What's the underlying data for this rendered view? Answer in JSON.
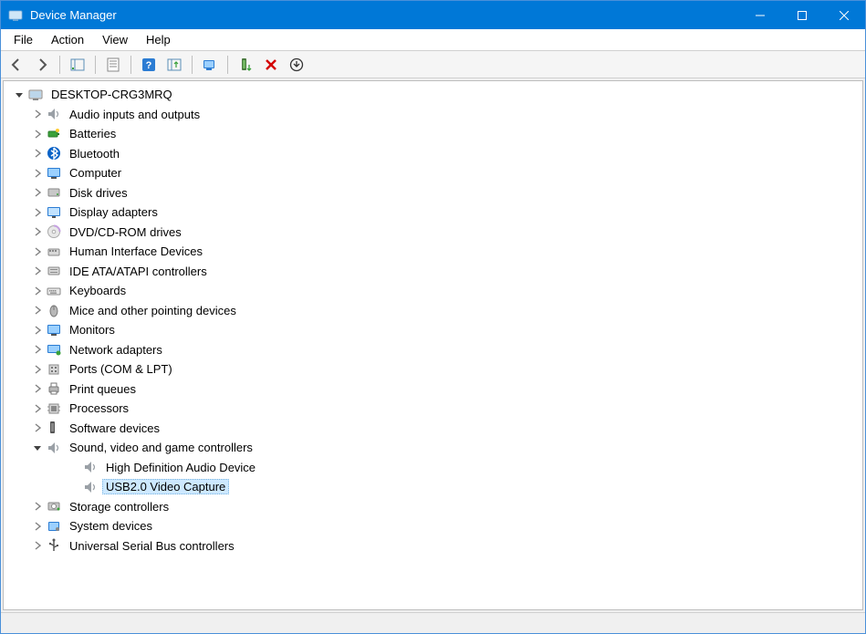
{
  "titlebar": {
    "title": "Device Manager"
  },
  "menu": {
    "file": "File",
    "action": "Action",
    "view": "View",
    "help": "Help"
  },
  "toolbar": {
    "back": "Back",
    "forward": "Forward",
    "show_hide_console_tree": "Show/Hide Console Tree",
    "properties": "Properties",
    "help": "Help",
    "update_driver": "Update Driver",
    "scan_hardware": "Scan for hardware changes",
    "uninstall": "Uninstall device",
    "disable": "Disable device",
    "add_legacy": "Add legacy hardware"
  },
  "tree": {
    "root": "DESKTOP-CRG3MRQ",
    "categories": [
      {
        "label": "Audio inputs and outputs",
        "icon": "speaker"
      },
      {
        "label": "Batteries",
        "icon": "battery"
      },
      {
        "label": "Bluetooth",
        "icon": "bluetooth"
      },
      {
        "label": "Computer",
        "icon": "monitor"
      },
      {
        "label": "Disk drives",
        "icon": "disk"
      },
      {
        "label": "Display adapters",
        "icon": "display"
      },
      {
        "label": "DVD/CD-ROM drives",
        "icon": "cd"
      },
      {
        "label": "Human Interface Devices",
        "icon": "hid"
      },
      {
        "label": "IDE ATA/ATAPI controllers",
        "icon": "ide"
      },
      {
        "label": "Keyboards",
        "icon": "keyboard"
      },
      {
        "label": "Mice and other pointing devices",
        "icon": "mouse"
      },
      {
        "label": "Monitors",
        "icon": "monitor"
      },
      {
        "label": "Network adapters",
        "icon": "network"
      },
      {
        "label": "Ports (COM & LPT)",
        "icon": "port"
      },
      {
        "label": "Print queues",
        "icon": "printer"
      },
      {
        "label": "Processors",
        "icon": "cpu"
      },
      {
        "label": "Software devices",
        "icon": "software"
      },
      {
        "label": "Sound, video and game controllers",
        "icon": "speaker",
        "expanded": true,
        "children": [
          {
            "label": "High Definition Audio Device",
            "icon": "speaker"
          },
          {
            "label": "USB2.0 Video Capture",
            "icon": "speaker",
            "selected": true
          }
        ]
      },
      {
        "label": "Storage controllers",
        "icon": "storage"
      },
      {
        "label": "System devices",
        "icon": "system"
      },
      {
        "label": "Universal Serial Bus controllers",
        "icon": "usb"
      }
    ]
  }
}
